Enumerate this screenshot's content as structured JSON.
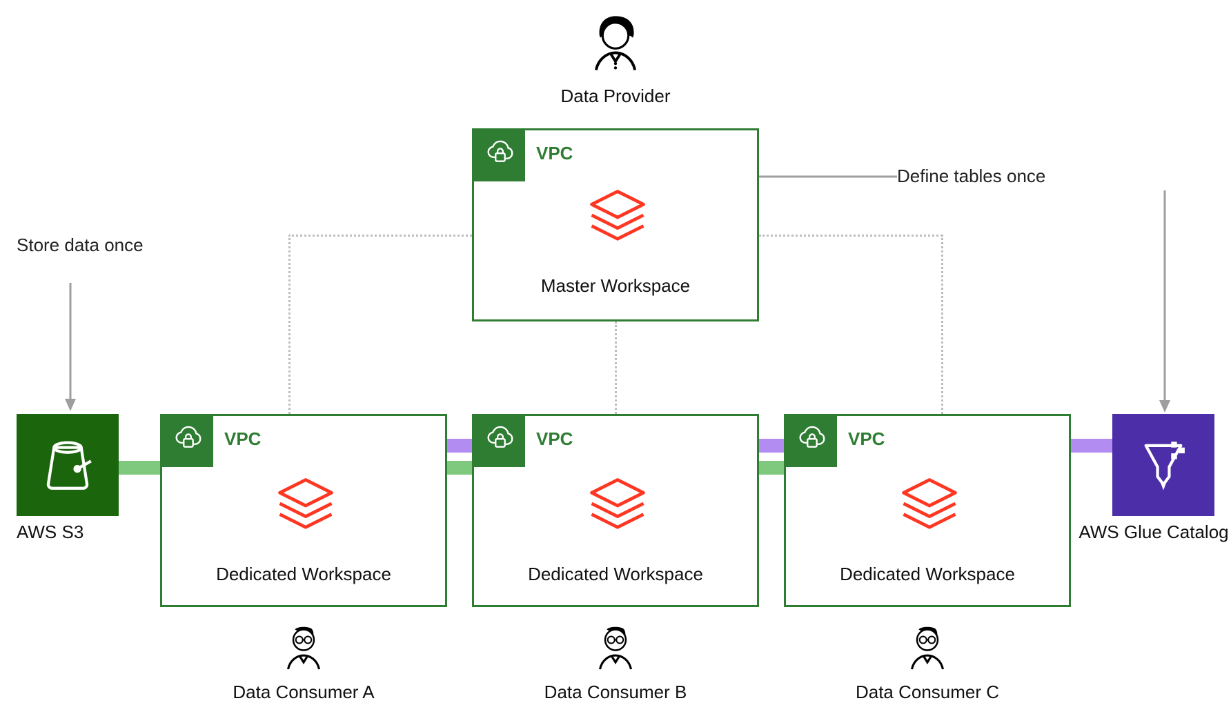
{
  "provider": {
    "label": "Data Provider"
  },
  "master_workspace": {
    "vpc_label": "VPC",
    "title": "Master Workspace"
  },
  "consumer_workspaces": [
    {
      "vpc_label": "VPC",
      "title": "Dedicated Workspace",
      "consumer_label": "Data Consumer A"
    },
    {
      "vpc_label": "VPC",
      "title": "Dedicated Workspace",
      "consumer_label": "Data Consumer B"
    },
    {
      "vpc_label": "VPC",
      "title": "Dedicated Workspace",
      "consumer_label": "Data Consumer C"
    }
  ],
  "left_store": {
    "label": "AWS S3"
  },
  "right_store": {
    "label": "AWS Glue Catalog"
  },
  "annotations": {
    "store_once": "Store data once",
    "define_once": "Define tables once"
  },
  "colors": {
    "vpc_green": "#2e7d32",
    "databricks_red": "#ff3621",
    "s3_green": "#1b660d",
    "glue_purple": "#4b2ea8",
    "conn_green": "#7fc97f",
    "conn_purple": "#b28cf0",
    "dotted_grey": "#bdbdbd"
  },
  "layout_kind": "architecture-diagram"
}
